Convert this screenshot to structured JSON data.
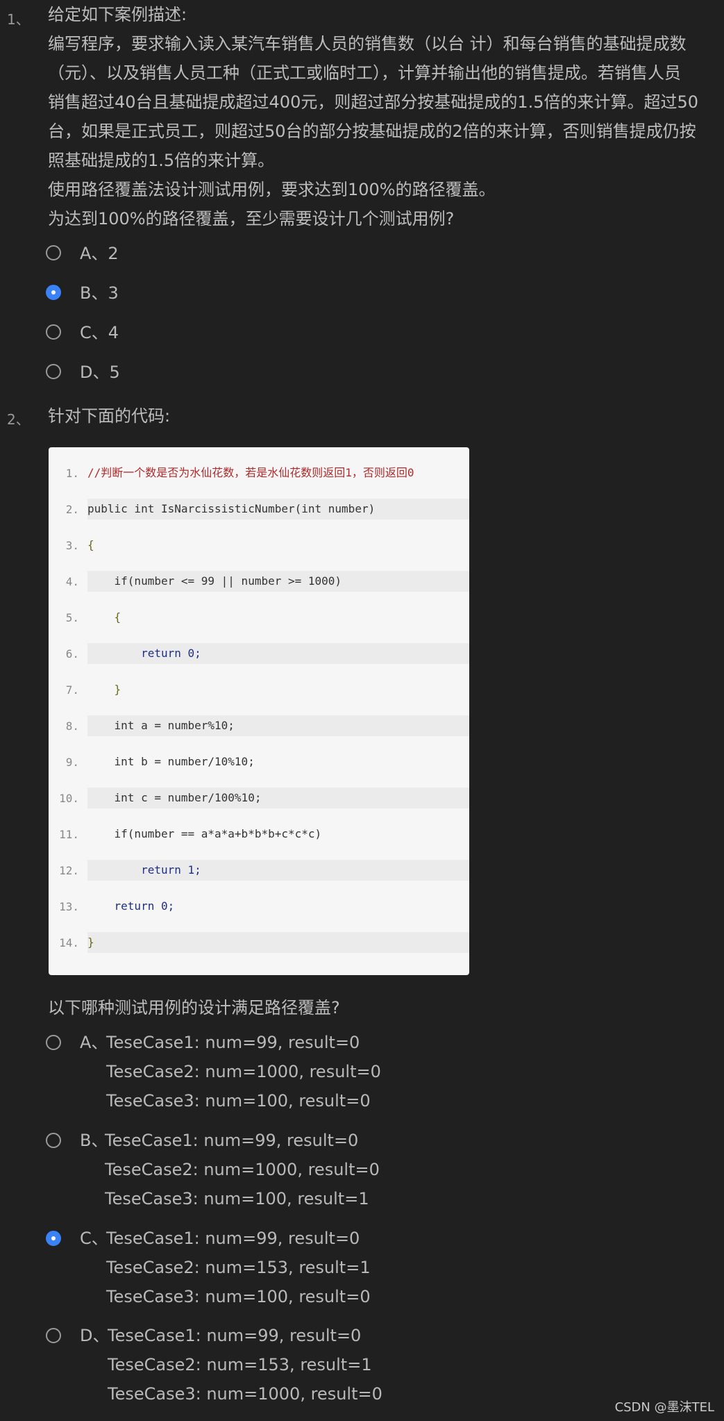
{
  "q1": {
    "num": "1、",
    "lines": [
      "给定如下案例描述:",
      "编写程序，要求输入读入某汽车销售人员的销售数（以台 计）和每台销售的基础提成数",
      "（元）、以及销售人员工种（正式工或临时工），计算并输出他的销售提成。若销售人员",
      "销售超过40台且基础提成超过400元，则超过部分按基础提成的1.5倍的来计算。超过50",
      "台，如果是正式员工，则超过50台的部分按基础提成的2倍的来计算，否则销售提成仍按",
      "照基础提成的1.5倍的来计算。",
      "使用路径覆盖法设计测试用例，要求达到100%的路径覆盖。",
      "为达到100%的路径覆盖，至少需要设计几个测试用例?"
    ],
    "options": [
      {
        "label": "A、2",
        "selected": false
      },
      {
        "label": "B、3",
        "selected": true
      },
      {
        "label": "C、4",
        "selected": false
      },
      {
        "label": "D、5",
        "selected": false
      }
    ]
  },
  "q2": {
    "num": "2、",
    "prompt": "针对下面的代码:",
    "code_lines": [
      "//判断一个数是否为水仙花数，若是水仙花数则返回1，否则返回0",
      "public int IsNarcissisticNumber(int number)",
      "{",
      "    if(number <= 99 || number >= 1000)",
      "    {",
      "        return 0;",
      "    }",
      "    int a = number%10;",
      "    int b = number/10%10;",
      "    int c = number/100%10;",
      "    if(number == a*a*a+b*b*b+c*c*c)",
      "        return 1;",
      "    return 0;",
      "}"
    ],
    "line_numbers": [
      "1.",
      "2.",
      "3.",
      "4.",
      "5.",
      "6.",
      "7.",
      "8.",
      "9.",
      "10.",
      "11.",
      "12.",
      "13.",
      "14."
    ],
    "question": "以下哪种测试用例的设计满足路径覆盖?",
    "options": [
      {
        "letter": "A、",
        "lines": [
          "TeseCase1: num=99, result=0",
          "TeseCase2: num=1000, result=0",
          "TeseCase3: num=100, result=0"
        ],
        "selected": false
      },
      {
        "letter": "B、",
        "lines": [
          "TeseCase1: num=99, result=0",
          "TeseCase2: num=1000, result=0",
          "TeseCase3: num=100, result=1"
        ],
        "selected": false
      },
      {
        "letter": "C、",
        "lines": [
          "TeseCase1: num=99, result=0",
          "TeseCase2: num=153, result=1",
          "TeseCase3: num=100, result=0"
        ],
        "selected": true
      },
      {
        "letter": "D、",
        "lines": [
          "TeseCase1: num=99, result=0",
          "TeseCase2: num=153, result=1",
          "TeseCase3: num=1000, result=0"
        ],
        "selected": false
      }
    ]
  },
  "watermark": "CSDN @墨沫TEL"
}
